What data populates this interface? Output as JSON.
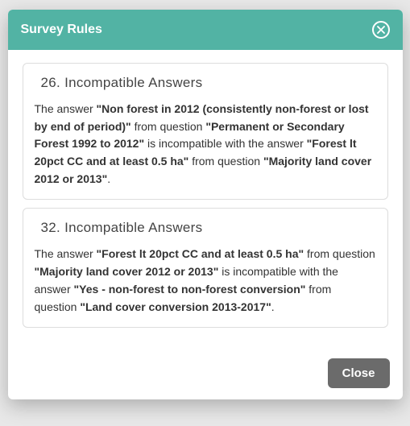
{
  "modal": {
    "title": "Survey Rules",
    "close_button_label": "Close"
  },
  "rules": [
    {
      "number": "26",
      "heading": "Incompatible Answers",
      "prefix1": "The answer ",
      "answer1": "\"Non forest in 2012 (consistently non-forest or lost by end of period)\"",
      "mid1": " from question ",
      "question1": "\"Permanent or Secondary Forest 1992 to 2012\"",
      "mid2": " is incompatible with the answer ",
      "answer2": "\"Forest lt 20pct CC and at least 0.5 ha\"",
      "mid3": " from question ",
      "question2": "\"Majority land cover 2012 or 2013\"",
      "suffix": "."
    },
    {
      "number": "32",
      "heading": "Incompatible Answers",
      "prefix1": "The answer ",
      "answer1": "\"Forest lt 20pct CC and at least 0.5 ha\"",
      "mid1": " from question ",
      "question1": "\"Majority land cover 2012 or 2013\"",
      "mid2": " is incompatible with the answer ",
      "answer2": "\"Yes - non-forest to non-forest conversion\"",
      "mid3": " from question ",
      "question2": "\"Land cover conversion 2013-2017\"",
      "suffix": "."
    }
  ]
}
